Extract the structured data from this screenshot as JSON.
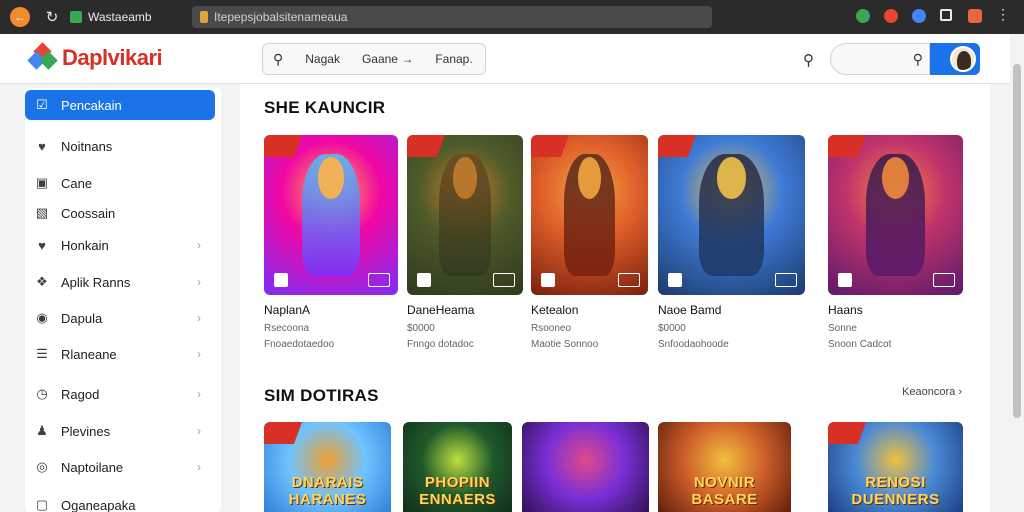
{
  "browser": {
    "tab_title": "Wastaeamb",
    "url": "Itepepsjobalsitenameaua",
    "colors": {
      "back": "#f28b30",
      "ext1": "#34a853",
      "ext2": "#ea4335",
      "ext3": "#4285f4"
    }
  },
  "header": {
    "logo_text": "Daplvikari",
    "categories": [
      "Nagak",
      "Gaane",
      "Fanap."
    ],
    "category_arrow": "→"
  },
  "sidebar": {
    "items": [
      {
        "label": "Pencakain",
        "icon": "check-square-icon",
        "glyph": "☑",
        "active": true,
        "chevron": false
      },
      {
        "label": "Noitnans",
        "icon": "heart-shield-icon",
        "glyph": "♥",
        "active": false,
        "chevron": false
      },
      {
        "label": "Cane",
        "icon": "briefcase-icon",
        "glyph": "▣",
        "active": false,
        "chevron": false
      },
      {
        "label": "Coossain",
        "icon": "image-icon",
        "glyph": "▧",
        "active": false,
        "chevron": false
      },
      {
        "label": "Honkain",
        "icon": "heart-icon",
        "glyph": "♥",
        "active": false,
        "chevron": true
      },
      {
        "label": "Aplik Ranns",
        "icon": "puzzle-icon",
        "glyph": "❖",
        "active": false,
        "chevron": true
      },
      {
        "label": "Dapula",
        "icon": "globe-icon",
        "glyph": "◉",
        "active": false,
        "chevron": true
      },
      {
        "label": "Rlaneane",
        "icon": "list-icon",
        "glyph": "☰",
        "active": false,
        "chevron": true
      },
      {
        "label": "Ragod",
        "icon": "clock-icon",
        "glyph": "◷",
        "active": false,
        "chevron": true
      },
      {
        "label": "Plevines",
        "icon": "person-icon",
        "glyph": "♟",
        "active": false,
        "chevron": true
      },
      {
        "label": "Naptoilane",
        "icon": "settings-icon",
        "glyph": "◎",
        "active": false,
        "chevron": true
      },
      {
        "label": "Oganeapaka",
        "icon": "box-icon",
        "glyph": "▢",
        "active": false,
        "chevron": false
      }
    ],
    "chevron_glyph": "›"
  },
  "main": {
    "section1": {
      "title": "SHE KAUNCIR",
      "cards": [
        {
          "name": "NaplanA",
          "sub1": "Rsecoona",
          "sub2": "Fnoaedotaedoo"
        },
        {
          "name": "DaneHeama",
          "sub1": "$0000",
          "sub2": "Fnngo dotadoc"
        },
        {
          "name": "Ketealon",
          "sub1": "Rsooneo",
          "sub2": "Maotie Sonnoo"
        },
        {
          "name": "Naoe Bamd",
          "sub1": "$0000",
          "sub2": "Snfoodaohoode"
        },
        {
          "name": "Haans",
          "sub1": "Sonne",
          "sub2": "Snoon Cadcot"
        }
      ]
    },
    "section2": {
      "title": "SIM DOTIRAS",
      "see_all": "Keaoncora ›",
      "cards": [
        {
          "art_text": "DNARAIS HARANES"
        },
        {
          "art_text": "PHOPIIN ENNAERS"
        },
        {
          "art_text": ""
        },
        {
          "art_text": "NOVNIR BASARE"
        },
        {
          "art_text": "RENOSI DUENNERS"
        }
      ]
    }
  }
}
